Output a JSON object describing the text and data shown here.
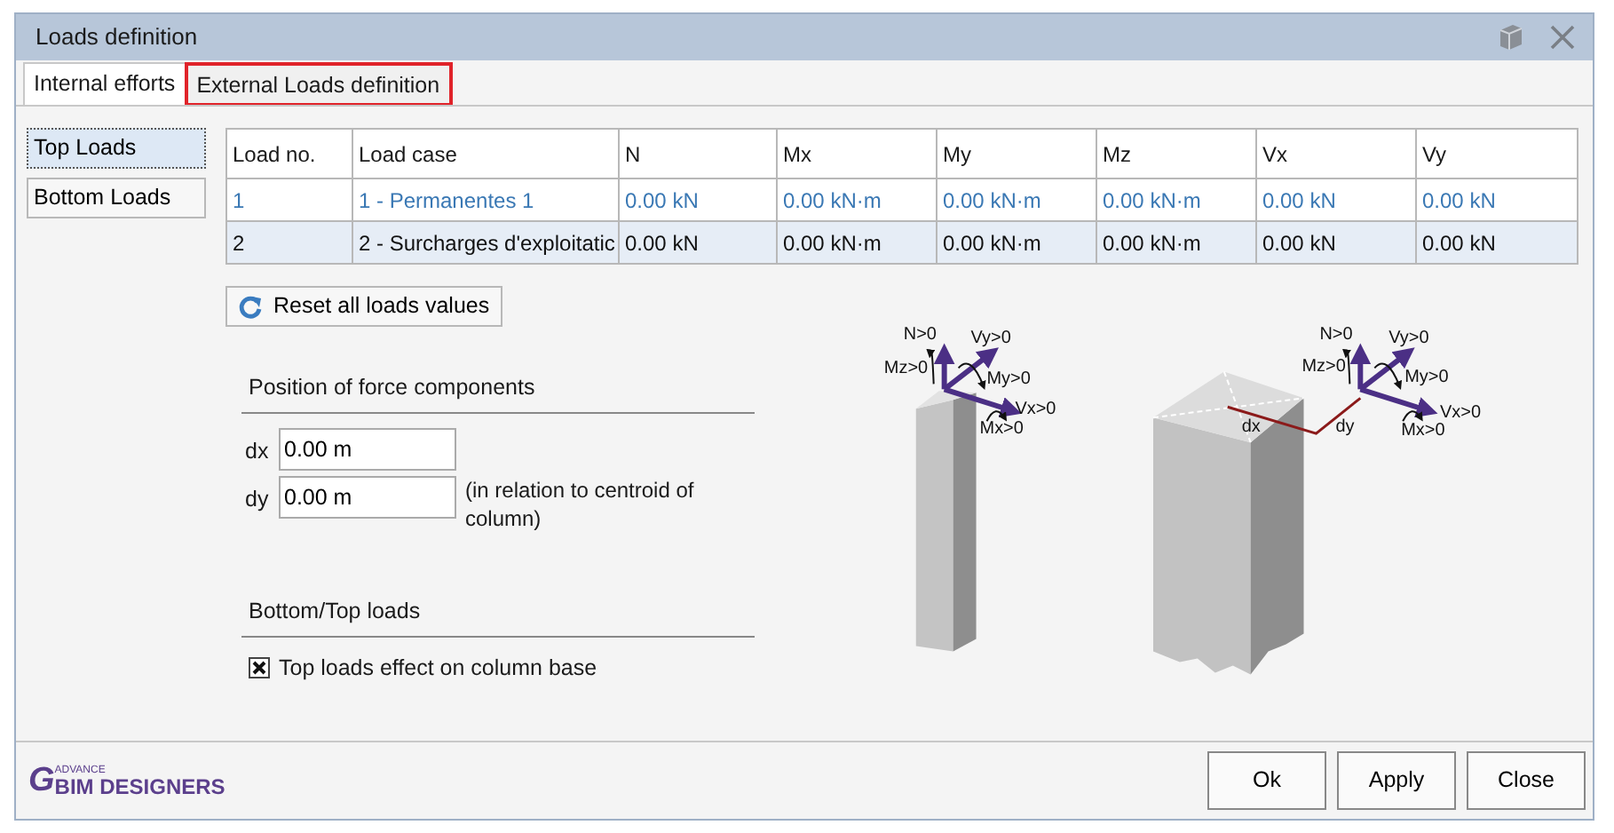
{
  "window": {
    "title": "Loads definition"
  },
  "tabs": [
    {
      "label": "Internal efforts",
      "selected": true,
      "highlighted": false
    },
    {
      "label": "External Loads definition",
      "selected": false,
      "highlighted": true
    }
  ],
  "sidebar": {
    "items": [
      {
        "label": "Top Loads",
        "selected": true
      },
      {
        "label": "Bottom Loads",
        "selected": false
      }
    ]
  },
  "table": {
    "columns": [
      "Load no.",
      "Load case",
      "N",
      "Mx",
      "My",
      "Mz",
      "Vx",
      "Vy"
    ],
    "rows": [
      {
        "selected": false,
        "cells": [
          "1",
          "1 - Permanentes 1",
          "0.00 kN",
          "0.00 kN·m",
          "0.00 kN·m",
          "0.00 kN·m",
          "0.00 kN",
          "0.00 kN"
        ]
      },
      {
        "selected": true,
        "cells": [
          "2",
          "2 - Surcharges d'exploitatic",
          "0.00 kN",
          "0.00 kN·m",
          "0.00 kN·m",
          "0.00 kN·m",
          "0.00 kN",
          "0.00 kN"
        ]
      }
    ]
  },
  "reset_button": "Reset all loads values",
  "position": {
    "heading": "Position of force components",
    "dx_label": "dx",
    "dx_value": "0.00 m",
    "dy_label": "dy",
    "dy_value": "0.00 m",
    "note": "(in relation to centroid of column)"
  },
  "bottom_top": {
    "heading": "Bottom/Top loads",
    "checkbox": {
      "label": "Top loads effect on column base",
      "checked": true
    }
  },
  "diagrams": [
    {
      "labels": [
        "N>0",
        "Vy>0",
        "Mz>0",
        "My>0",
        "Vx>0",
        "Mx>0"
      ]
    },
    {
      "labels": [
        "N>0",
        "Vy>0",
        "Mz>0",
        "My>0",
        "Vx>0",
        "Mx>0"
      ],
      "offset_labels": [
        "dx",
        "dy"
      ]
    }
  ],
  "logo": {
    "mark": "G",
    "small": "ADVANCE",
    "name": "BIM DESIGNERS"
  },
  "buttons": [
    "Ok",
    "Apply",
    "Close"
  ]
}
